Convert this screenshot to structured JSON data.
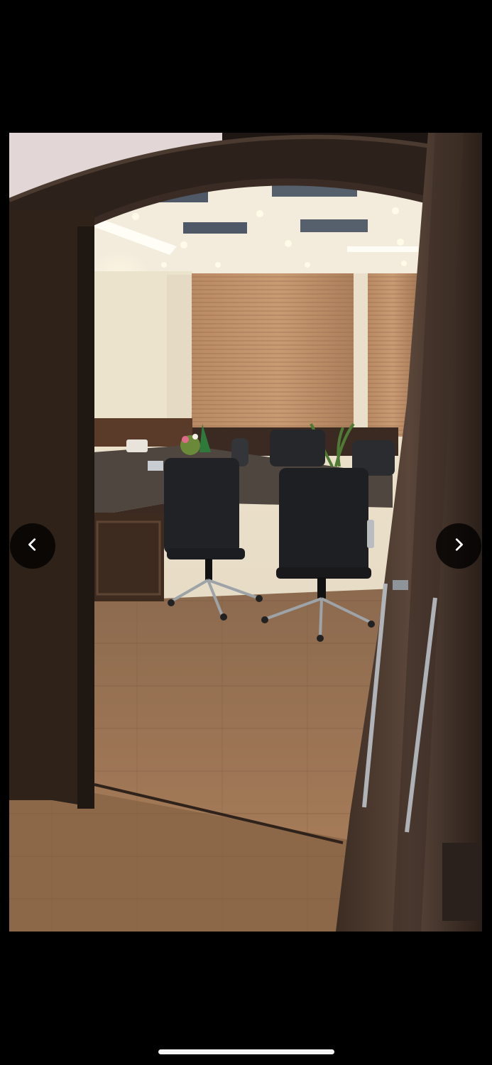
{
  "viewer": {
    "photo_subject": "office-conference-room",
    "previous_icon": "chevron-left-icon",
    "next_icon": "chevron-right-icon"
  },
  "colors": {
    "background": "#000000",
    "nav_button": "#000000",
    "nav_icon": "#ffffff",
    "home_indicator": "#f4f4f4"
  }
}
